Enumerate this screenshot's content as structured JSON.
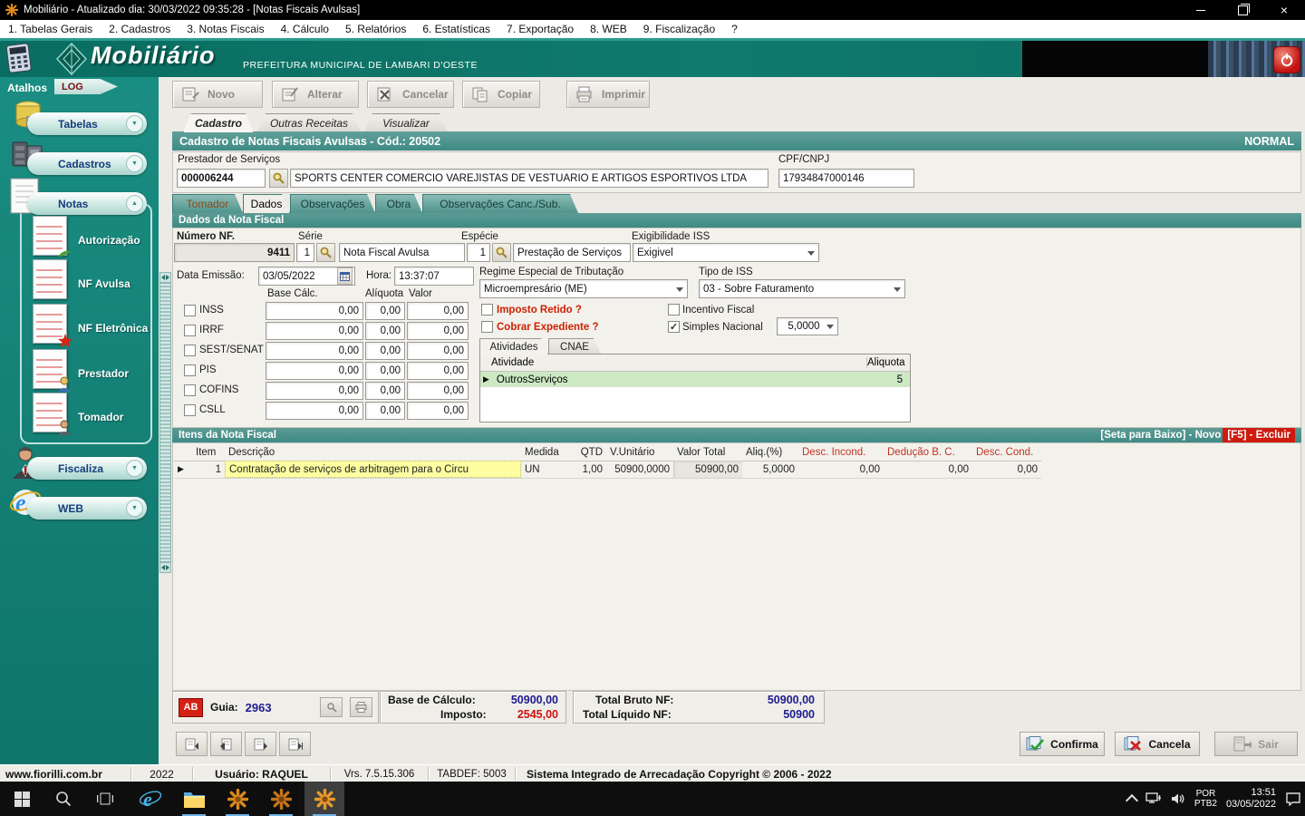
{
  "window": {
    "title": "Mobiliário - Atualizado dia: 30/03/2022 09:35:28 - [Notas Fiscais Avulsas]"
  },
  "menubar": {
    "items": [
      "1. Tabelas Gerais",
      "2. Cadastros",
      "3. Notas Fiscais",
      "4. Cálculo",
      "5. Relatórios",
      "6. Estatísticas",
      "7. Exportação",
      "8. WEB",
      "9. Fiscalização",
      "?"
    ]
  },
  "banner": {
    "logo": "Mobiliário",
    "subtitle": "PREFEITURA MUNICIPAL DE LAMBARI D'OESTE"
  },
  "sidebar": {
    "atalhos": "Atalhos",
    "log": "LOG",
    "tabelas": "Tabelas",
    "cadastros": "Cadastros",
    "notas": "Notas",
    "notas_items": [
      "Autorização",
      "NF Avulsa",
      "NF Eletrônica",
      "Prestador",
      "Tomador"
    ],
    "fiscaliza": "Fiscaliza",
    "web": "WEB"
  },
  "toolbar": {
    "novo": "Novo",
    "alterar": "Alterar",
    "cancelar": "Cancelar",
    "copiar": "Copiar",
    "imprimir": "Imprimir"
  },
  "tabs": {
    "cadastro": "Cadastro",
    "outras": "Outras Receitas",
    "visualizar": "Visualizar"
  },
  "section": {
    "title": "Cadastro de Notas Fiscais Avulsas - Cód.: 20502",
    "status": "NORMAL"
  },
  "prestador": {
    "label": "Prestador de Serviços",
    "code": "000006244",
    "name": "SPORTS CENTER COMERCIO VAREJISTAS DE VESTUARIO E ARTIGOS ESPORTIVOS LTDA",
    "cpf_label": "CPF/CNPJ",
    "cpf": "17934847000146"
  },
  "inner_tabs": [
    "Tomador",
    "Dados",
    "Observações",
    "Obra",
    "Observações Canc./Sub."
  ],
  "dados": {
    "header": "Dados da Nota Fiscal",
    "numero_label": "Número NF.",
    "numero": "9411",
    "serie_label": "Série",
    "serie": "1",
    "serie_nome": "Nota Fiscal Avulsa",
    "especie_label": "Espécie",
    "especie": "1",
    "especie_nome": "Prestação de Serviços",
    "exigibilidade_label": "Exigibilidade ISS",
    "exigibilidade": "Exigivel",
    "data_label": "Data Emissão:",
    "data": "03/05/2022",
    "hora_label": "Hora:",
    "hora": "13:37:07",
    "regime_label": "Regime Especial de Tributação",
    "regime": "Microempresário (ME)",
    "tipo_iss_label": "Tipo de ISS",
    "tipo_iss": "03 - Sobre Faturamento"
  },
  "impostos": {
    "col_base": "Base Cálc.",
    "col_aliquota": "Alíquota",
    "col_valor": "Valor",
    "rows": [
      {
        "nome": "INSS",
        "base": "0,00",
        "aliquota": "0,00",
        "valor": "0,00"
      },
      {
        "nome": "IRRF",
        "base": "0,00",
        "aliquota": "0,00",
        "valor": "0,00"
      },
      {
        "nome": "SEST/SENAT",
        "base": "0,00",
        "aliquota": "0,00",
        "valor": "0,00"
      },
      {
        "nome": "PIS",
        "base": "0,00",
        "aliquota": "0,00",
        "valor": "0,00"
      },
      {
        "nome": "COFINS",
        "base": "0,00",
        "aliquota": "0,00",
        "valor": "0,00"
      },
      {
        "nome": "CSLL",
        "base": "0,00",
        "aliquota": "0,00",
        "valor": "0,00"
      }
    ]
  },
  "flags": {
    "imposto_retido": "Imposto Retido ?",
    "cobrar_expediente": "Cobrar Expediente ?",
    "incentivo_fiscal": "Incentivo Fiscal",
    "simples_nacional": "Simples Nacional",
    "simples_aliquota": "5,0000"
  },
  "atividades": {
    "tab_atividades": "Atividades",
    "tab_cnae": "CNAE",
    "col_atividade": "Atividade",
    "col_aliquota": "Aliquota",
    "atividade": "OutrosServiços",
    "aliquota": "5"
  },
  "itens": {
    "header": "Itens da Nota Fiscal",
    "hint_novo": "[Seta para Baixo] - Novo",
    "hint_excluir": "[F5] - Excluir",
    "cols": [
      "Item",
      "Descrição",
      "Medida",
      "QTD",
      "V.Unitário",
      "Valor Total",
      "Aliq.(%)",
      "Desc. Incond.",
      "Dedução B. C.",
      "Desc. Cond."
    ],
    "row": {
      "item": "1",
      "descricao": "Contratação de serviços de arbitragem para o Circu",
      "medida": "UN",
      "qtd": "1,00",
      "v_unitario": "50900,0000",
      "valor_total": "50900,00",
      "aliq": "5,0000",
      "desc_incond": "0,00",
      "deducao_bc": "0,00",
      "desc_cond": "0,00"
    }
  },
  "totais": {
    "ab": "AB",
    "guia_label": "Guia:",
    "guia": "2963",
    "base_label": "Base de Cálculo:",
    "base": "50900,00",
    "imposto_label": "Imposto:",
    "imposto": "2545,00",
    "bruto_label": "Total Bruto NF:",
    "bruto": "50900,00",
    "liquido_label": "Total Líquido NF:",
    "liquido": "50900"
  },
  "acoes": {
    "confirma": "Confirma",
    "cancela": "Cancela",
    "sair": "Sair"
  },
  "statusbar": {
    "site": "www.fiorilli.com.br",
    "ano": "2022",
    "usuario": "Usuário: RAQUEL",
    "versao": "Vrs. 7.5.15.306",
    "tabdef": "TABDEF: 5003",
    "copyright": "Sistema Integrado de Arrecadação Copyright © 2006 - 2022"
  },
  "taskbar": {
    "lang_top": "POR",
    "lang_bottom": "PTB2",
    "time": "13:51",
    "date": "03/05/2022"
  },
  "icons": {
    "check": "✓",
    "row_marker": "▶",
    "chevron_down": "▼",
    "chevron_up": "▲"
  },
  "colors": {
    "teal_bar": "#3e8b85",
    "sidebar_teal": "#15837a",
    "alert_red": "#cc2200",
    "value_navy": "#1c1c8f",
    "highlight_yellow": "#ffffa2",
    "highlight_green": "#cde9c4"
  }
}
